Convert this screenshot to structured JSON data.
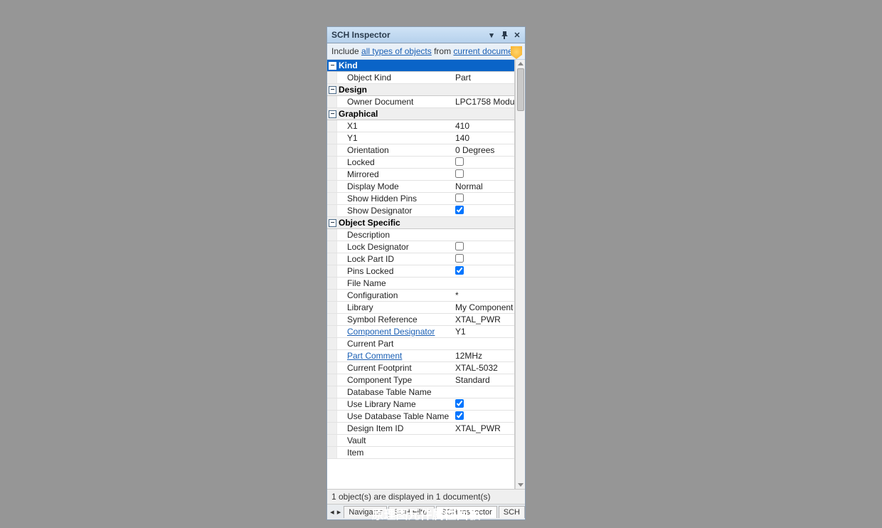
{
  "window": {
    "title": "SCH Inspector"
  },
  "infobar": {
    "prefix": "Include ",
    "link1": "all types of objects",
    "mid": " from ",
    "link2": "current document"
  },
  "groups": [
    {
      "name": "Kind",
      "selected": true,
      "rows": [
        {
          "label": "Object Kind",
          "value": "Part",
          "type": "text"
        }
      ]
    },
    {
      "name": "Design",
      "rows": [
        {
          "label": "Owner Document",
          "value": "LPC1758 Modul",
          "type": "text"
        }
      ]
    },
    {
      "name": "Graphical",
      "rows": [
        {
          "label": "X1",
          "value": "410",
          "type": "text"
        },
        {
          "label": "Y1",
          "value": "140",
          "type": "text"
        },
        {
          "label": "Orientation",
          "value": "0 Degrees",
          "type": "text"
        },
        {
          "label": "Locked",
          "value": false,
          "type": "check"
        },
        {
          "label": "Mirrored",
          "value": false,
          "type": "check"
        },
        {
          "label": "Display Mode",
          "value": "Normal",
          "type": "text"
        },
        {
          "label": "Show Hidden Pins",
          "value": false,
          "type": "check"
        },
        {
          "label": "Show Designator",
          "value": true,
          "type": "check"
        }
      ]
    },
    {
      "name": "Object Specific",
      "rows": [
        {
          "label": "Description",
          "value": "",
          "type": "text"
        },
        {
          "label": "Lock Designator",
          "value": false,
          "type": "check"
        },
        {
          "label": "Lock Part ID",
          "value": false,
          "type": "check"
        },
        {
          "label": "Pins Locked",
          "value": true,
          "type": "check"
        },
        {
          "label": "File Name",
          "value": "",
          "type": "text"
        },
        {
          "label": "Configuration",
          "value": "*",
          "type": "text"
        },
        {
          "label": "Library",
          "value": "My Component",
          "type": "text"
        },
        {
          "label": "Symbol Reference",
          "value": "XTAL_PWR",
          "type": "text"
        },
        {
          "label": "Component Designator",
          "value": "Y1",
          "type": "text",
          "link": true
        },
        {
          "label": "Current Part",
          "value": "",
          "type": "text"
        },
        {
          "label": "Part Comment",
          "value": "12MHz",
          "type": "text",
          "link": true
        },
        {
          "label": "Current Footprint",
          "value": "XTAL-5032",
          "type": "text"
        },
        {
          "label": "Component Type",
          "value": "Standard",
          "type": "text"
        },
        {
          "label": "Database Table Name",
          "value": "",
          "type": "text"
        },
        {
          "label": "Use Library Name",
          "value": true,
          "type": "check"
        },
        {
          "label": "Use Database Table Name",
          "value": true,
          "type": "check"
        },
        {
          "label": "Design Item ID",
          "value": "XTAL_PWR",
          "type": "text"
        },
        {
          "label": "Vault",
          "value": "",
          "type": "text"
        },
        {
          "label": "Item",
          "value": "",
          "type": "text"
        }
      ]
    }
  ],
  "status": "1 object(s) are displayed in 1 document(s)",
  "tabs": {
    "items": [
      "Navigator",
      "SCH Filter",
      "SCH Inspector",
      "SCH"
    ],
    "active": 2
  },
  "caption": "原理图元件属性面板"
}
